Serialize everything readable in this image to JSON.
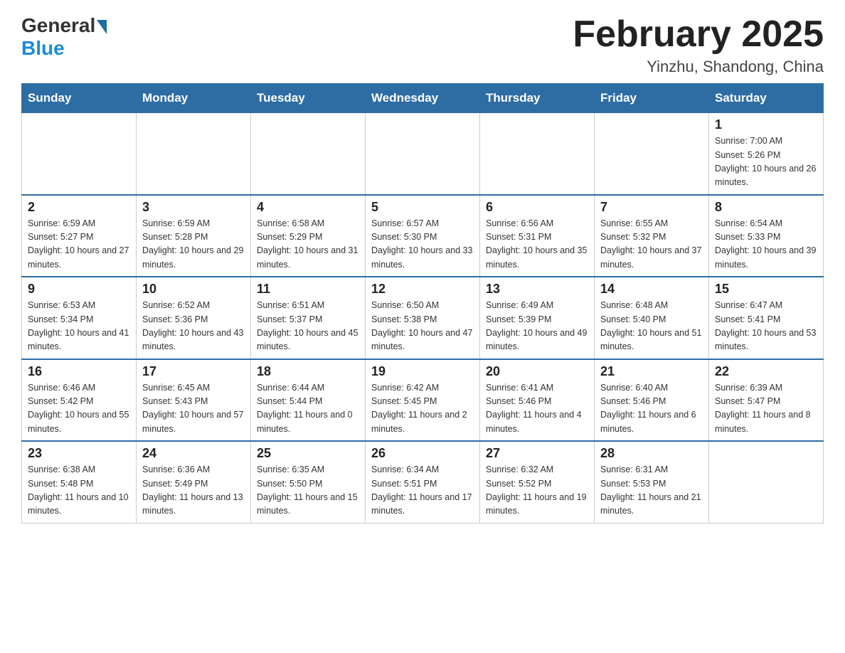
{
  "logo": {
    "general": "General",
    "blue": "Blue"
  },
  "header": {
    "title": "February 2025",
    "location": "Yinzhu, Shandong, China"
  },
  "days_of_week": [
    "Sunday",
    "Monday",
    "Tuesday",
    "Wednesday",
    "Thursday",
    "Friday",
    "Saturday"
  ],
  "weeks": [
    [
      {
        "day": "",
        "info": ""
      },
      {
        "day": "",
        "info": ""
      },
      {
        "day": "",
        "info": ""
      },
      {
        "day": "",
        "info": ""
      },
      {
        "day": "",
        "info": ""
      },
      {
        "day": "",
        "info": ""
      },
      {
        "day": "1",
        "info": "Sunrise: 7:00 AM\nSunset: 5:26 PM\nDaylight: 10 hours and 26 minutes."
      }
    ],
    [
      {
        "day": "2",
        "info": "Sunrise: 6:59 AM\nSunset: 5:27 PM\nDaylight: 10 hours and 27 minutes."
      },
      {
        "day": "3",
        "info": "Sunrise: 6:59 AM\nSunset: 5:28 PM\nDaylight: 10 hours and 29 minutes."
      },
      {
        "day": "4",
        "info": "Sunrise: 6:58 AM\nSunset: 5:29 PM\nDaylight: 10 hours and 31 minutes."
      },
      {
        "day": "5",
        "info": "Sunrise: 6:57 AM\nSunset: 5:30 PM\nDaylight: 10 hours and 33 minutes."
      },
      {
        "day": "6",
        "info": "Sunrise: 6:56 AM\nSunset: 5:31 PM\nDaylight: 10 hours and 35 minutes."
      },
      {
        "day": "7",
        "info": "Sunrise: 6:55 AM\nSunset: 5:32 PM\nDaylight: 10 hours and 37 minutes."
      },
      {
        "day": "8",
        "info": "Sunrise: 6:54 AM\nSunset: 5:33 PM\nDaylight: 10 hours and 39 minutes."
      }
    ],
    [
      {
        "day": "9",
        "info": "Sunrise: 6:53 AM\nSunset: 5:34 PM\nDaylight: 10 hours and 41 minutes."
      },
      {
        "day": "10",
        "info": "Sunrise: 6:52 AM\nSunset: 5:36 PM\nDaylight: 10 hours and 43 minutes."
      },
      {
        "day": "11",
        "info": "Sunrise: 6:51 AM\nSunset: 5:37 PM\nDaylight: 10 hours and 45 minutes."
      },
      {
        "day": "12",
        "info": "Sunrise: 6:50 AM\nSunset: 5:38 PM\nDaylight: 10 hours and 47 minutes."
      },
      {
        "day": "13",
        "info": "Sunrise: 6:49 AM\nSunset: 5:39 PM\nDaylight: 10 hours and 49 minutes."
      },
      {
        "day": "14",
        "info": "Sunrise: 6:48 AM\nSunset: 5:40 PM\nDaylight: 10 hours and 51 minutes."
      },
      {
        "day": "15",
        "info": "Sunrise: 6:47 AM\nSunset: 5:41 PM\nDaylight: 10 hours and 53 minutes."
      }
    ],
    [
      {
        "day": "16",
        "info": "Sunrise: 6:46 AM\nSunset: 5:42 PM\nDaylight: 10 hours and 55 minutes."
      },
      {
        "day": "17",
        "info": "Sunrise: 6:45 AM\nSunset: 5:43 PM\nDaylight: 10 hours and 57 minutes."
      },
      {
        "day": "18",
        "info": "Sunrise: 6:44 AM\nSunset: 5:44 PM\nDaylight: 11 hours and 0 minutes."
      },
      {
        "day": "19",
        "info": "Sunrise: 6:42 AM\nSunset: 5:45 PM\nDaylight: 11 hours and 2 minutes."
      },
      {
        "day": "20",
        "info": "Sunrise: 6:41 AM\nSunset: 5:46 PM\nDaylight: 11 hours and 4 minutes."
      },
      {
        "day": "21",
        "info": "Sunrise: 6:40 AM\nSunset: 5:46 PM\nDaylight: 11 hours and 6 minutes."
      },
      {
        "day": "22",
        "info": "Sunrise: 6:39 AM\nSunset: 5:47 PM\nDaylight: 11 hours and 8 minutes."
      }
    ],
    [
      {
        "day": "23",
        "info": "Sunrise: 6:38 AM\nSunset: 5:48 PM\nDaylight: 11 hours and 10 minutes."
      },
      {
        "day": "24",
        "info": "Sunrise: 6:36 AM\nSunset: 5:49 PM\nDaylight: 11 hours and 13 minutes."
      },
      {
        "day": "25",
        "info": "Sunrise: 6:35 AM\nSunset: 5:50 PM\nDaylight: 11 hours and 15 minutes."
      },
      {
        "day": "26",
        "info": "Sunrise: 6:34 AM\nSunset: 5:51 PM\nDaylight: 11 hours and 17 minutes."
      },
      {
        "day": "27",
        "info": "Sunrise: 6:32 AM\nSunset: 5:52 PM\nDaylight: 11 hours and 19 minutes."
      },
      {
        "day": "28",
        "info": "Sunrise: 6:31 AM\nSunset: 5:53 PM\nDaylight: 11 hours and 21 minutes."
      },
      {
        "day": "",
        "info": ""
      }
    ]
  ]
}
